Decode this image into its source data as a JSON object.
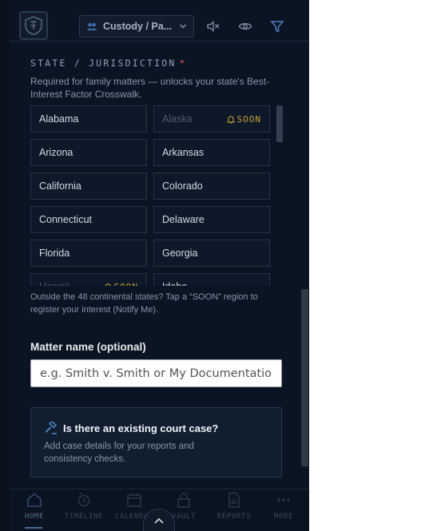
{
  "colors": {
    "background": "#0b1422",
    "accent": "#3f6fb0",
    "soon": "#c9a23a",
    "required": "#e05252"
  },
  "header": {
    "logo_icon": "shield-logo-icon",
    "case_selector": {
      "value": "Custody / Pa...",
      "icon": "custody-scales-icon"
    },
    "icons": [
      "mute-icon",
      "eye-icon",
      "filter-icon"
    ]
  },
  "jurisdiction": {
    "label": "STATE / JURISDICTION",
    "required_mark": "*",
    "help": "Required for family matters — unlocks your state's Best-Interest Factor Crosswalk.",
    "states": [
      {
        "name": "Alabama",
        "soon": false
      },
      {
        "name": "Alaska",
        "soon": true,
        "badge": "SOON"
      },
      {
        "name": "Arizona",
        "soon": false
      },
      {
        "name": "Arkansas",
        "soon": false
      },
      {
        "name": "California",
        "soon": false
      },
      {
        "name": "Colorado",
        "soon": false
      },
      {
        "name": "Connecticut",
        "soon": false
      },
      {
        "name": "Delaware",
        "soon": false
      },
      {
        "name": "Florida",
        "soon": false
      },
      {
        "name": "Georgia",
        "soon": false
      },
      {
        "name": "Hawaii",
        "soon": true,
        "badge": "SOON"
      },
      {
        "name": "Idaho",
        "soon": false
      }
    ],
    "outside_note": "Outside the 48 continental states? Tap a “SOON” region to register your interest (Notify Me)."
  },
  "matter": {
    "label": "Matter name (optional)",
    "value": "",
    "placeholder": "e.g. Smith v. Smith or My Documentation"
  },
  "court_case": {
    "title": "Is there an existing court case?",
    "description": "Add case details for your reports and consistency checks."
  },
  "nav": {
    "items": [
      {
        "label": "HOME",
        "icon": "home-icon",
        "active": true
      },
      {
        "label": "TIMELINE",
        "icon": "timeline-icon",
        "active": false
      },
      {
        "label": "CALENDAR",
        "icon": "calendar-icon",
        "active": false
      },
      {
        "label": "VAULT",
        "icon": "lock-icon",
        "active": false
      },
      {
        "label": "REPORTS",
        "icon": "reports-icon",
        "active": false
      },
      {
        "label": "MORE",
        "icon": "more-icon",
        "active": false
      }
    ]
  }
}
